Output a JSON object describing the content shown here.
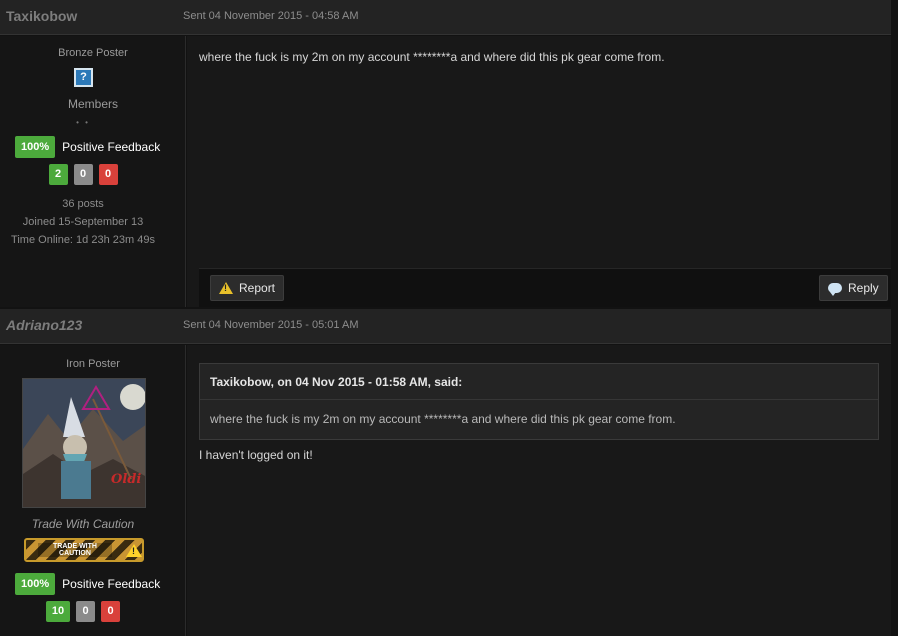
{
  "posts": [
    {
      "author": "Taxikobow",
      "sent": "Sent 04 November 2015 - 04:58 AM",
      "rank": "Bronze Poster",
      "group": "Members",
      "pips": "• •",
      "feedback_percent": "100%",
      "feedback_label": "Positive Feedback",
      "feedback_counts": [
        "2",
        "0",
        "0"
      ],
      "posts": "36 posts",
      "joined": "Joined 15-September 13",
      "time_online": "Time Online: 1d 23h 23m 49s",
      "message": "where the fuck is my 2m on my account ********a and where did this pk gear come from.",
      "report_label": "Report",
      "reply_label": "Reply"
    },
    {
      "author": "Adriano123",
      "sent": "Sent 04 November 2015 - 05:01 AM",
      "rank": "Iron Poster",
      "title": "Trade With Caution",
      "caution_badge": "TRADE WITH CAUTION",
      "feedback_percent": "100%",
      "feedback_label": "Positive Feedback",
      "feedback_counts": [
        "10",
        "0",
        "0"
      ],
      "quote_citation": "Taxikobow, on 04 Nov 2015 - 01:58 AM, said:",
      "quote_text": "where the fuck is my 2m on my account ********a and where did this pk gear come from.",
      "message": "I haven't logged on it!",
      "avatar_text": "Oldi Daddy"
    }
  ],
  "colors": {
    "positive": "#4caa3c",
    "neutral": "#8b8b8b",
    "negative": "#d9413b"
  }
}
